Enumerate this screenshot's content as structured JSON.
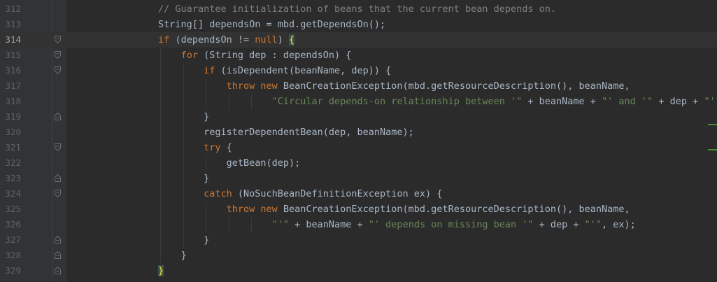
{
  "editor": {
    "current_line": 314,
    "lines": [
      {
        "num": "312",
        "indent": 4,
        "tokens": [
          {
            "c": "com",
            "t": "// Guarantee initialization of beans that the current bean depends on."
          }
        ]
      },
      {
        "num": "313",
        "indent": 4,
        "tokens": [
          {
            "c": "p",
            "t": "String[] dependsOn = mbd.getDependsOn();"
          }
        ]
      },
      {
        "num": "314",
        "indent": 4,
        "fold": "open",
        "current": true,
        "tokens": [
          {
            "c": "kw",
            "t": "if"
          },
          {
            "c": "p",
            "t": " (dependsOn != "
          },
          {
            "c": "kw",
            "t": "null"
          },
          {
            "c": "p",
            "t": ") "
          },
          {
            "c": "hl",
            "t": "{"
          }
        ]
      },
      {
        "num": "315",
        "indent": 5,
        "fold": "open",
        "tokens": [
          {
            "c": "kw",
            "t": "for"
          },
          {
            "c": "p",
            "t": " (String dep : dependsOn) {"
          }
        ]
      },
      {
        "num": "316",
        "indent": 6,
        "fold": "open",
        "tokens": [
          {
            "c": "kw",
            "t": "if"
          },
          {
            "c": "p",
            "t": " (isDependent(beanName, dep)) {"
          }
        ]
      },
      {
        "num": "317",
        "indent": 7,
        "tokens": [
          {
            "c": "kw",
            "t": "throw new"
          },
          {
            "c": "p",
            "t": " BeanCreationException(mbd.getResourceDescription(), beanName,"
          }
        ]
      },
      {
        "num": "318",
        "indent": 9,
        "tokens": [
          {
            "c": "str",
            "t": "\"Circular depends-on relationship between '\""
          },
          {
            "c": "p",
            "t": " + beanName + "
          },
          {
            "c": "str",
            "t": "\"' and '\""
          },
          {
            "c": "p",
            "t": " + dep + "
          },
          {
            "c": "str",
            "t": "\"'\""
          },
          {
            "c": "p",
            "t": ");"
          }
        ]
      },
      {
        "num": "319",
        "indent": 6,
        "fold": "close",
        "tokens": [
          {
            "c": "p",
            "t": "}"
          }
        ]
      },
      {
        "num": "320",
        "indent": 6,
        "tokens": [
          {
            "c": "p",
            "t": "registerDependentBean(dep, beanName);"
          }
        ]
      },
      {
        "num": "321",
        "indent": 6,
        "fold": "open",
        "tokens": [
          {
            "c": "kw",
            "t": "try"
          },
          {
            "c": "p",
            "t": " {"
          }
        ]
      },
      {
        "num": "322",
        "indent": 7,
        "tokens": [
          {
            "c": "p",
            "t": "getBean(dep);"
          }
        ]
      },
      {
        "num": "323",
        "indent": 6,
        "fold": "close",
        "tokens": [
          {
            "c": "p",
            "t": "}"
          }
        ]
      },
      {
        "num": "324",
        "indent": 6,
        "fold": "open",
        "tokens": [
          {
            "c": "kw",
            "t": "catch"
          },
          {
            "c": "p",
            "t": " (NoSuchBeanDefinitionException ex) {"
          }
        ]
      },
      {
        "num": "325",
        "indent": 7,
        "tokens": [
          {
            "c": "kw",
            "t": "throw new"
          },
          {
            "c": "p",
            "t": " BeanCreationException(mbd.getResourceDescription(), beanName,"
          }
        ]
      },
      {
        "num": "326",
        "indent": 9,
        "tokens": [
          {
            "c": "str",
            "t": "\"'\""
          },
          {
            "c": "p",
            "t": " + beanName + "
          },
          {
            "c": "str",
            "t": "\"' depends on missing bean '\""
          },
          {
            "c": "p",
            "t": " + dep + "
          },
          {
            "c": "str",
            "t": "\"'\""
          },
          {
            "c": "p",
            "t": ", ex);"
          }
        ]
      },
      {
        "num": "327",
        "indent": 6,
        "fold": "close",
        "tokens": [
          {
            "c": "p",
            "t": "}"
          }
        ]
      },
      {
        "num": "328",
        "indent": 5,
        "fold": "close",
        "tokens": [
          {
            "c": "p",
            "t": "}"
          }
        ]
      },
      {
        "num": "329",
        "indent": 4,
        "fold": "close",
        "tokens": [
          {
            "c": "hl",
            "t": "}"
          }
        ]
      }
    ]
  }
}
